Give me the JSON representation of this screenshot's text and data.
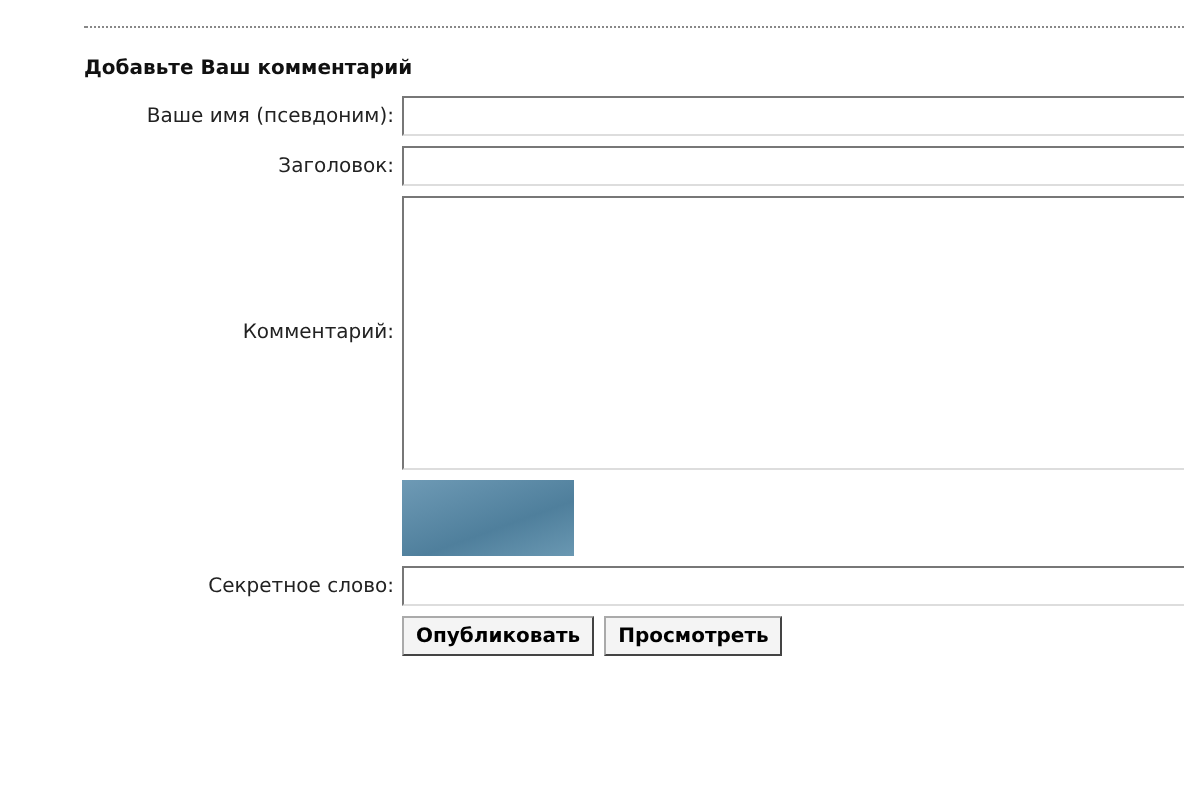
{
  "form": {
    "title": "Добавьте Ваш комментарий",
    "fields": [
      {
        "kind": "input",
        "label": "Ваше имя (псевдоним):"
      },
      {
        "kind": "input",
        "label": "Заголовок:"
      },
      {
        "kind": "textarea",
        "label": "Комментарий:"
      },
      {
        "kind": "captcha"
      },
      {
        "kind": "input",
        "label": "Секретное слово:"
      }
    ],
    "buttons": [
      "Опубликовать",
      "Просмотреть"
    ]
  }
}
